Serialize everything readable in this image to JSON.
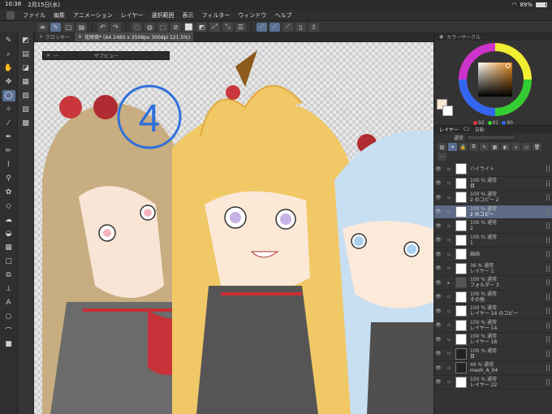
{
  "status": {
    "time": "10:38",
    "date": "2月15日(水)",
    "battery": "89%",
    "battery_level": 0.89
  },
  "menu": [
    "ファイル",
    "編集",
    "アニメーション",
    "レイヤー",
    "選択範囲",
    "表示",
    "フィルター",
    "ウィンドウ",
    "ヘルプ"
  ],
  "tabs": [
    {
      "label": "クロッキー"
    },
    {
      "label": "花映夜* (A4 2480 x 3508px 300dpi 121.5%)"
    }
  ],
  "subview": {
    "label": "サブビュー"
  },
  "color_panel": {
    "title": "カラーサークル",
    "h": "92",
    "s": "91",
    "v": "90",
    "accent": "#6a8ad8"
  },
  "layer_panel": {
    "tabs": [
      "レイヤー",
      "C1",
      "自動"
    ],
    "blend": "通常",
    "layers": [
      {
        "opacity": "",
        "mode": "ハイライト",
        "name": "",
        "thumb": "white",
        "sel": false
      },
      {
        "opacity": "100 %",
        "mode": "通常",
        "name": "目",
        "thumb": "white",
        "sel": false
      },
      {
        "opacity": "100 %",
        "mode": "通常",
        "name": "2 のコピー 2",
        "thumb": "white",
        "sel": false
      },
      {
        "opacity": "100 %",
        "mode": "通常",
        "name": "2 のコピー",
        "thumb": "white",
        "sel": true
      },
      {
        "opacity": "100 %",
        "mode": "通常",
        "name": "2",
        "thumb": "white",
        "sel": false
      },
      {
        "opacity": "100 %",
        "mode": "通常",
        "name": "1",
        "thumb": "white",
        "sel": false
      },
      {
        "opacity": "",
        "mode": "線画",
        "name": "",
        "thumb": "white",
        "sel": false
      },
      {
        "opacity": "36 %",
        "mode": "通常",
        "name": "レイヤー 1",
        "thumb": "white",
        "sel": false
      },
      {
        "opacity": "100 %",
        "mode": "通常",
        "name": "フォルダー 3",
        "thumb": "folder",
        "sel": false
      },
      {
        "opacity": "100 %",
        "mode": "通常",
        "name": "その他",
        "thumb": "white",
        "sel": false
      },
      {
        "opacity": "100 %",
        "mode": "通常",
        "name": "レイヤー 14 のコピー",
        "thumb": "white",
        "sel": false
      },
      {
        "opacity": "100 %",
        "mode": "通常",
        "name": "レイヤー 14",
        "thumb": "white",
        "sel": false
      },
      {
        "opacity": "100 %",
        "mode": "通常",
        "name": "レイヤー 16",
        "thumb": "white",
        "sel": false
      },
      {
        "opacity": "100 %",
        "mode": "通常",
        "name": "目",
        "thumb": "dark",
        "sel": false
      },
      {
        "opacity": "46 %",
        "mode": "通常",
        "name": "mesh_A_04",
        "thumb": "dark",
        "sel": false
      },
      {
        "opacity": "100 %",
        "mode": "通常",
        "name": "レイヤー 22",
        "thumb": "white",
        "sel": false
      }
    ]
  },
  "canvas": {
    "number_label": "4"
  }
}
